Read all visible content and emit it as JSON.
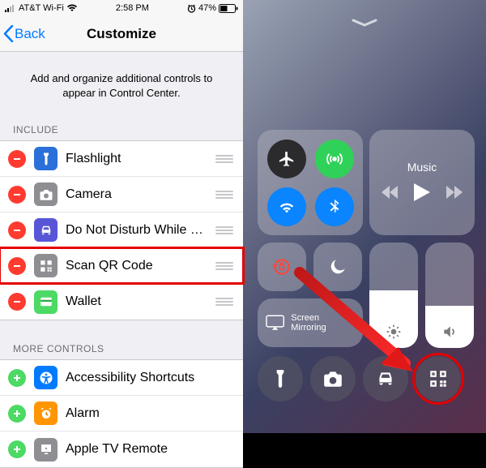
{
  "status": {
    "carrier": "AT&T Wi-Fi",
    "time": "2:58 PM",
    "battery": "47%"
  },
  "nav": {
    "back": "Back",
    "title": "Customize"
  },
  "intro": "Add and organize additional controls to appear in Control Center.",
  "sections": {
    "include": "Include",
    "more": "More Controls"
  },
  "include": [
    {
      "label": "Flashlight",
      "iconBg": "#2b6fd9",
      "icon": "flashlight"
    },
    {
      "label": "Camera",
      "iconBg": "#8e8e93",
      "icon": "camera"
    },
    {
      "label": "Do Not Disturb While Driving",
      "iconBg": "#5856d6",
      "icon": "car"
    },
    {
      "label": "Scan QR Code",
      "iconBg": "#8e8e93",
      "icon": "qrcode",
      "highlight": true
    },
    {
      "label": "Wallet",
      "iconBg": "#4cd964",
      "icon": "wallet"
    }
  ],
  "more": [
    {
      "label": "Accessibility Shortcuts",
      "iconBg": "#007aff",
      "icon": "accessibility"
    },
    {
      "label": "Alarm",
      "iconBg": "#ff9500",
      "icon": "alarm"
    },
    {
      "label": "Apple TV Remote",
      "iconBg": "#8e8e93",
      "icon": "appletv"
    }
  ],
  "controlCenter": {
    "musicLabel": "Music",
    "screenMirroring": "Screen Mirroring",
    "brightnessPct": 55,
    "volumePct": 40
  },
  "colors": {
    "iosBlue": "#007aff",
    "ccBlue": "#0a84ff",
    "ccGreen": "#30d158",
    "ccDark": "#2b2b2e",
    "removeRed": "#ff3b30",
    "addGreen": "#4cd964"
  }
}
